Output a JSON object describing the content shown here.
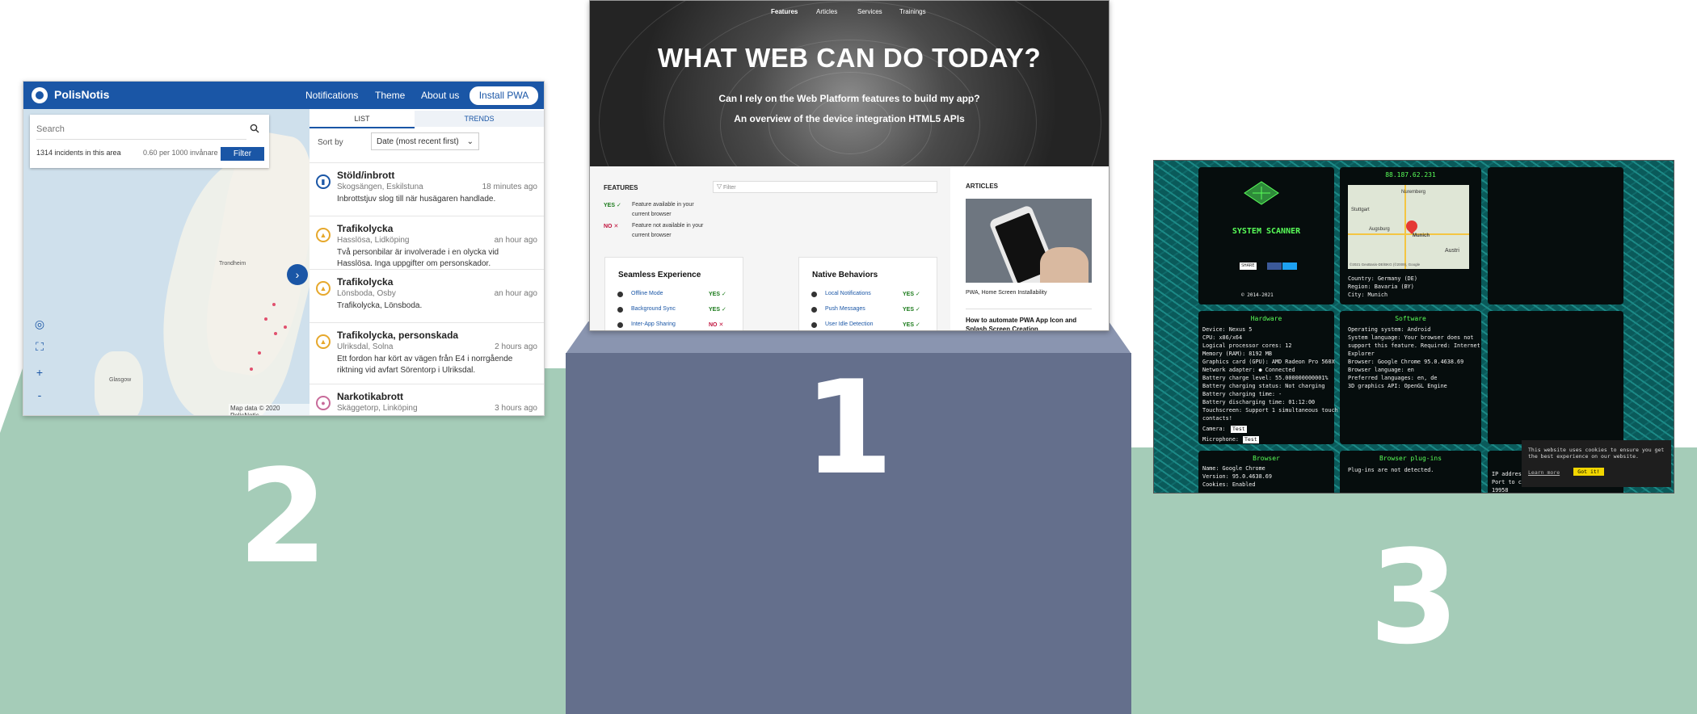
{
  "podium": {
    "first_label": "1",
    "second_label": "2",
    "third_label": "3",
    "colors": {
      "side": "#a5ccb8",
      "center": "#646f8c",
      "number": "#ffffff"
    }
  },
  "polisnotis": {
    "brand": "PolisNotis",
    "nav": [
      "Notifications",
      "Theme",
      "About us"
    ],
    "install_label": "Install PWA",
    "search_placeholder": "Search",
    "incident_count": "1314 incidents in this area",
    "rate": "0.60 per 1000 invånare",
    "filter_label": "Filter",
    "tabs": [
      "LIST",
      "TRENDS"
    ],
    "sort_label": "Sort by",
    "sort_value": "Date (most recent first)",
    "map_attribution": "Map data © 2020 PolisNotis",
    "map_labels": [
      "Trondheim",
      "Glasgow"
    ],
    "incidents": [
      {
        "title": "Stöld/inbrott",
        "location": "Skogsängen, Eskilstuna",
        "time": "18 minutes ago",
        "description": "Inbrottstjuv slog till när husägaren handlade."
      },
      {
        "title": "Trafikolycka",
        "location": "Hasslösa, Lidköping",
        "time": "an hour ago",
        "description": "Två personbilar är involverade i en olycka vid Hasslösa. Inga uppgifter om personskador."
      },
      {
        "title": "Trafikolycka",
        "location": "Lönsboda, Osby",
        "time": "an hour ago",
        "description": "Trafikolycka, Lönsboda."
      },
      {
        "title": "Trafikolycka, personskada",
        "location": "Ulriksdal, Solna",
        "time": "2 hours ago",
        "description": "Ett fordon har kört av vägen från E4 i norrgående riktning vid avfart Sörentorp i Ulriksdal."
      },
      {
        "title": "Narkotikabrott",
        "location": "Skäggetorp, Linköping",
        "time": "3 hours ago",
        "description": ""
      }
    ],
    "colors": {
      "brand": "#1a56a6"
    }
  },
  "wwcd": {
    "nav": [
      "Features",
      "Articles",
      "Services",
      "Trainings"
    ],
    "title": "WHAT WEB CAN DO TODAY?",
    "subtitle_1": "Can I rely on the Web Platform features to build my app?",
    "subtitle_2": "An overview of the device integration HTML5 APIs",
    "features_heading": "FEATURES",
    "filter_placeholder": "Filter",
    "legend": [
      {
        "key": "YES ✓",
        "text": "Feature available in your current browser"
      },
      {
        "key": "NO ✕",
        "text": "Feature not available in your current browser"
      }
    ],
    "articles_heading": "ARTICLES",
    "cards": [
      {
        "title": "Seamless Experience",
        "features": [
          {
            "name": "Offline Mode",
            "value": "YES ✓"
          },
          {
            "name": "Background Sync",
            "value": "YES ✓"
          },
          {
            "name": "Inter-App Sharing",
            "value": "NO ✕"
          }
        ]
      },
      {
        "title": "Native Behaviors",
        "features": [
          {
            "name": "Local Notifications",
            "value": "YES ✓"
          },
          {
            "name": "Push Messages",
            "value": "YES ✓"
          },
          {
            "name": "User Idle Detection",
            "value": "YES ✓"
          }
        ]
      }
    ],
    "article_caption": "PWA, Home Screen Installability",
    "article_title": "How to automate PWA App Icon and Splash Screen Creation",
    "colors": {
      "yes": "#1a7a1a",
      "no": "#c0123c",
      "link": "#1a56a6"
    }
  },
  "scanner": {
    "ip": "88.187.62.231",
    "title": "SYSTEM SCANNER",
    "share_label": "SHARE",
    "copyright": "© 2014-2021",
    "map_labels": [
      "Nuremberg",
      "Stuttgart",
      "Augsburg",
      "Munich",
      "Austri"
    ],
    "map_attribution": "©2021 GeoBasis-DE/BKG (©2009), Google",
    "location": [
      "Country: Germany (DE)",
      "Region: Bavaria (BY)",
      "City: Munich"
    ],
    "hardware_heading": "Hardware",
    "hardware": [
      "Device: Nexus 5",
      "CPU: x86/x64",
      "Logical processor cores: 12",
      "Memory (RAM): 8192 MB",
      "Graphics card (GPU): AMD Radeon Pro 560X",
      "Network adapter: ● Connected",
      "Battery charge level: 55.000000000001%",
      "Battery charging status: Not charging",
      "Battery charging time: -",
      "Battery discharging time: 01:12:00",
      "Touchscreen: Support 1 simultaneous touch",
      "contacts!"
    ],
    "camera_label": "Camera:",
    "microphone_label": "Microphone:",
    "test_label": "Test",
    "software_heading": "Software",
    "software": [
      "Operating system: Android",
      "System language: Your browser does not",
      "support this feature. Required: Internet",
      "Explorer",
      "Browser: Google Chrome 95.0.4638.69",
      "Browser language: en",
      "Preferred languages: en, de",
      "3D graphics API: OpenGL Engine"
    ],
    "browser_heading": "Browser",
    "browser": [
      "Name: Google Chrome",
      "Version: 95.0.4638.69",
      "Cookies: Enabled"
    ],
    "plugins_heading": "Browser plug-ins",
    "plugins": [
      "Plug-ins are not detected."
    ],
    "ip_partial": [
      "IP address",
      "Port to c",
      "19958"
    ],
    "cookie_text": "This website uses cookies to ensure you get the best experience on our website.",
    "cookie_learn": "Learn more",
    "cookie_accept": "Got it!",
    "colors": {
      "accent": "#59ff59",
      "bg": "#0a5a5a",
      "cookie_button": "#f1d600"
    }
  }
}
